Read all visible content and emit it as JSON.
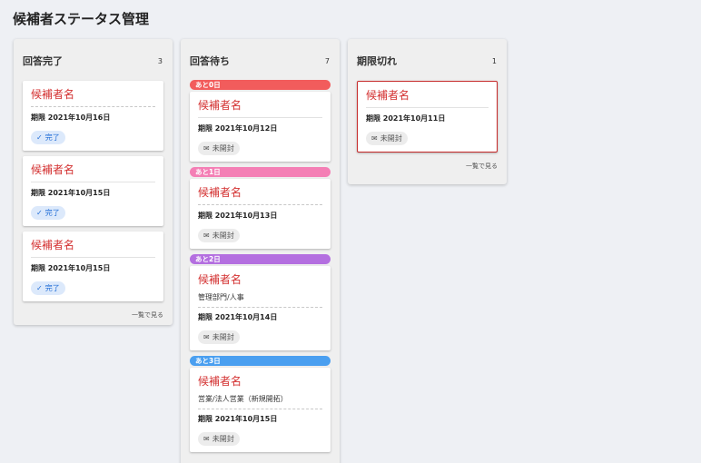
{
  "page": {
    "title": "候補者ステータス管理"
  },
  "columns": [
    {
      "title": "回答完了",
      "count": "3",
      "see_all": "一覧で見る",
      "cards": [
        {
          "name": "候補者名",
          "deadline": "期限 2021年10月16日",
          "status": "完了",
          "status_icon": "person-check-icon"
        },
        {
          "name": "候補者名",
          "deadline": "期限 2021年10月15日",
          "status": "完了",
          "status_icon": "person-check-icon"
        },
        {
          "name": "候補者名",
          "deadline": "期限 2021年10月15日",
          "status": "完了",
          "status_icon": "person-check-icon"
        }
      ]
    },
    {
      "title": "回答待ち",
      "count": "7",
      "groups": [
        {
          "badge": "あと0日",
          "badge_color": "#f25c5c",
          "cards": [
            {
              "name": "候補者名",
              "deadline": "期限 2021年10月12日",
              "status": "未開封",
              "status_icon": "unopened-mail-icon"
            }
          ]
        },
        {
          "badge": "あと1日",
          "badge_color": "#f47fb5",
          "cards": [
            {
              "name": "候補者名",
              "deadline": "期限 2021年10月13日",
              "status": "未開封",
              "status_icon": "unopened-mail-icon"
            }
          ]
        },
        {
          "badge": "あと2日",
          "badge_color": "#b46fe0",
          "cards": [
            {
              "name": "候補者名",
              "dept": "管理部門/人事",
              "deadline": "期限 2021年10月14日",
              "status": "未開封",
              "status_icon": "unopened-mail-icon"
            }
          ]
        },
        {
          "badge": "あと3日",
          "badge_color": "#4a9ff0",
          "cards": [
            {
              "name": "候補者名",
              "dept": "営業/法人営業（新規開拓）",
              "deadline": "期限 2021年10月15日",
              "status": "未開封",
              "status_icon": "unopened-mail-icon"
            }
          ]
        }
      ]
    },
    {
      "title": "期限切れ",
      "count": "1",
      "see_all": "一覧で見る",
      "cards": [
        {
          "name": "候補者名",
          "deadline": "期限 2021年10月11日",
          "status": "未開封",
          "status_icon": "unopened-mail-icon"
        }
      ]
    }
  ]
}
